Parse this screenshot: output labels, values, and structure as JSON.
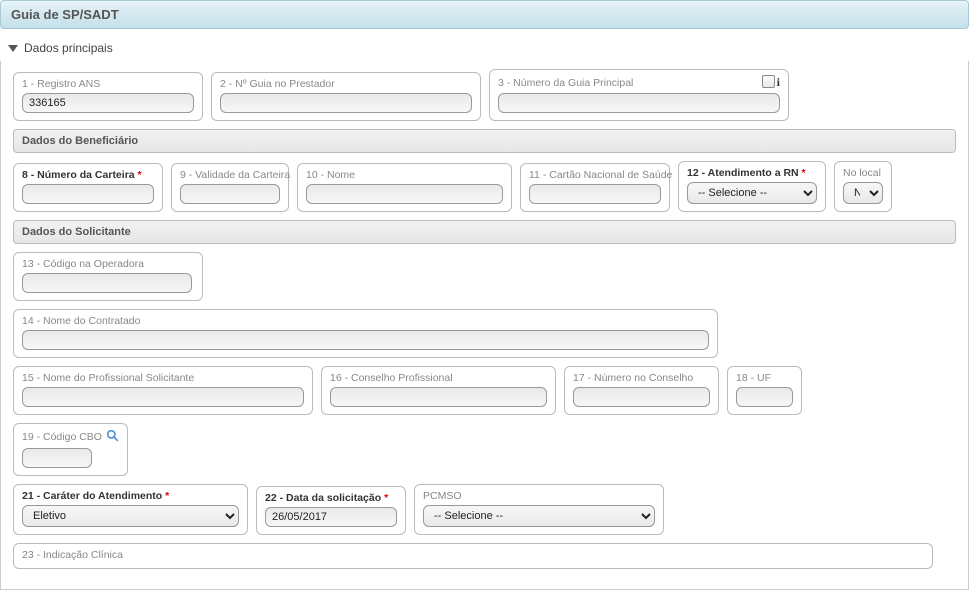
{
  "header": {
    "title": "Guia de SP/SADT"
  },
  "section": {
    "title": "Dados principais"
  },
  "fields": {
    "f1": {
      "label": "1 - Registro ANS",
      "value": "336165"
    },
    "f2": {
      "label": "2 - Nº Guia no Prestador",
      "value": ""
    },
    "f3": {
      "label": "3 - Número da Guia Principal",
      "value": ""
    }
  },
  "beneficiario": {
    "header": "Dados do Beneficiário",
    "f8": {
      "label": "8 - Número da Carteira",
      "value": ""
    },
    "f9": {
      "label": "9 - Validade da Carteira",
      "value": ""
    },
    "f10": {
      "label": "10 - Nome",
      "value": ""
    },
    "f11": {
      "label": "11 - Cartão Nacional de Saúde",
      "value": ""
    },
    "f12": {
      "label": "12 - Atendimento a RN",
      "placeholder": "-- Selecione --"
    },
    "local": {
      "label": "No local",
      "value": "Não"
    }
  },
  "solicitante": {
    "header": "Dados do Solicitante",
    "f13": {
      "label": "13 - Código na Operadora",
      "value": ""
    },
    "f14": {
      "label": "14 - Nome do Contratado",
      "value": ""
    },
    "f15": {
      "label": "15 - Nome do Profissional Solicitante",
      "value": ""
    },
    "f16": {
      "label": "16 - Conselho Profissional",
      "value": ""
    },
    "f17": {
      "label": "17 - Número no Conselho",
      "value": ""
    },
    "f18": {
      "label": "18 - UF",
      "value": ""
    },
    "f19": {
      "label": "19 - Código CBO",
      "value": ""
    },
    "f21": {
      "label": "21 - Caráter do Atendimento",
      "value": "Eletivo"
    },
    "f22": {
      "label": "22 - Data da solicitação",
      "value": "26/05/2017"
    },
    "pcmso": {
      "label": "PCMSO",
      "placeholder": "-- Selecione --"
    },
    "f23": {
      "label": "23 - Indicação Clínica",
      "value": ""
    }
  }
}
